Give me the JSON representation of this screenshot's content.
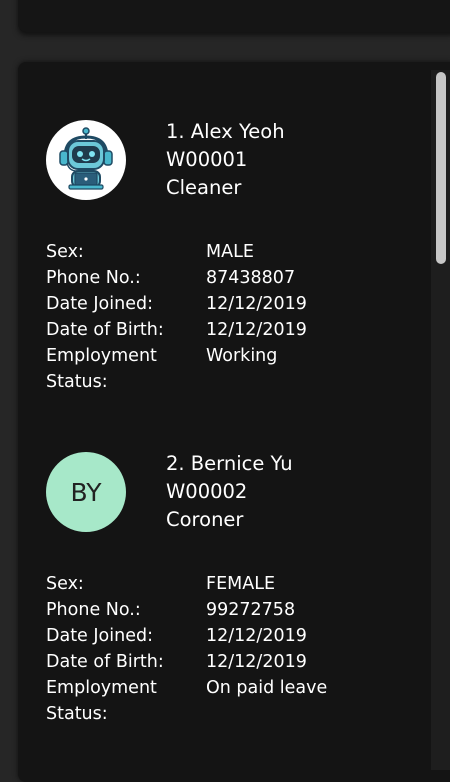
{
  "employees": [
    {
      "header": "1. Alex Yeoh",
      "id": "W00001",
      "role": "Cleaner",
      "avatar_type": "robot-icon",
      "fields": [
        {
          "label": "Sex:",
          "value": "MALE"
        },
        {
          "label": "Phone No.:",
          "value": "87438807"
        },
        {
          "label": "Date Joined:",
          "value": "12/12/2019"
        },
        {
          "label": "Date of Birth:",
          "value": "12/12/2019"
        },
        {
          "label": "Employment\nStatus:",
          "value": "Working"
        }
      ]
    },
    {
      "header": "2. Bernice Yu",
      "id": "W00002",
      "role": "Coroner",
      "avatar_initials": "BY",
      "fields": [
        {
          "label": "Sex:",
          "value": "FEMALE"
        },
        {
          "label": "Phone No.:",
          "value": "99272758"
        },
        {
          "label": "Date Joined:",
          "value": "12/12/2019"
        },
        {
          "label": "Date of Birth:",
          "value": "12/12/2019"
        },
        {
          "label": "Employment\nStatus:",
          "value": "On paid leave"
        }
      ]
    }
  ],
  "colors": {
    "background": "#262626",
    "panel": "#141414",
    "initials_avatar": "#a7e8c9",
    "scroll_thumb": "#c8c8c8"
  }
}
